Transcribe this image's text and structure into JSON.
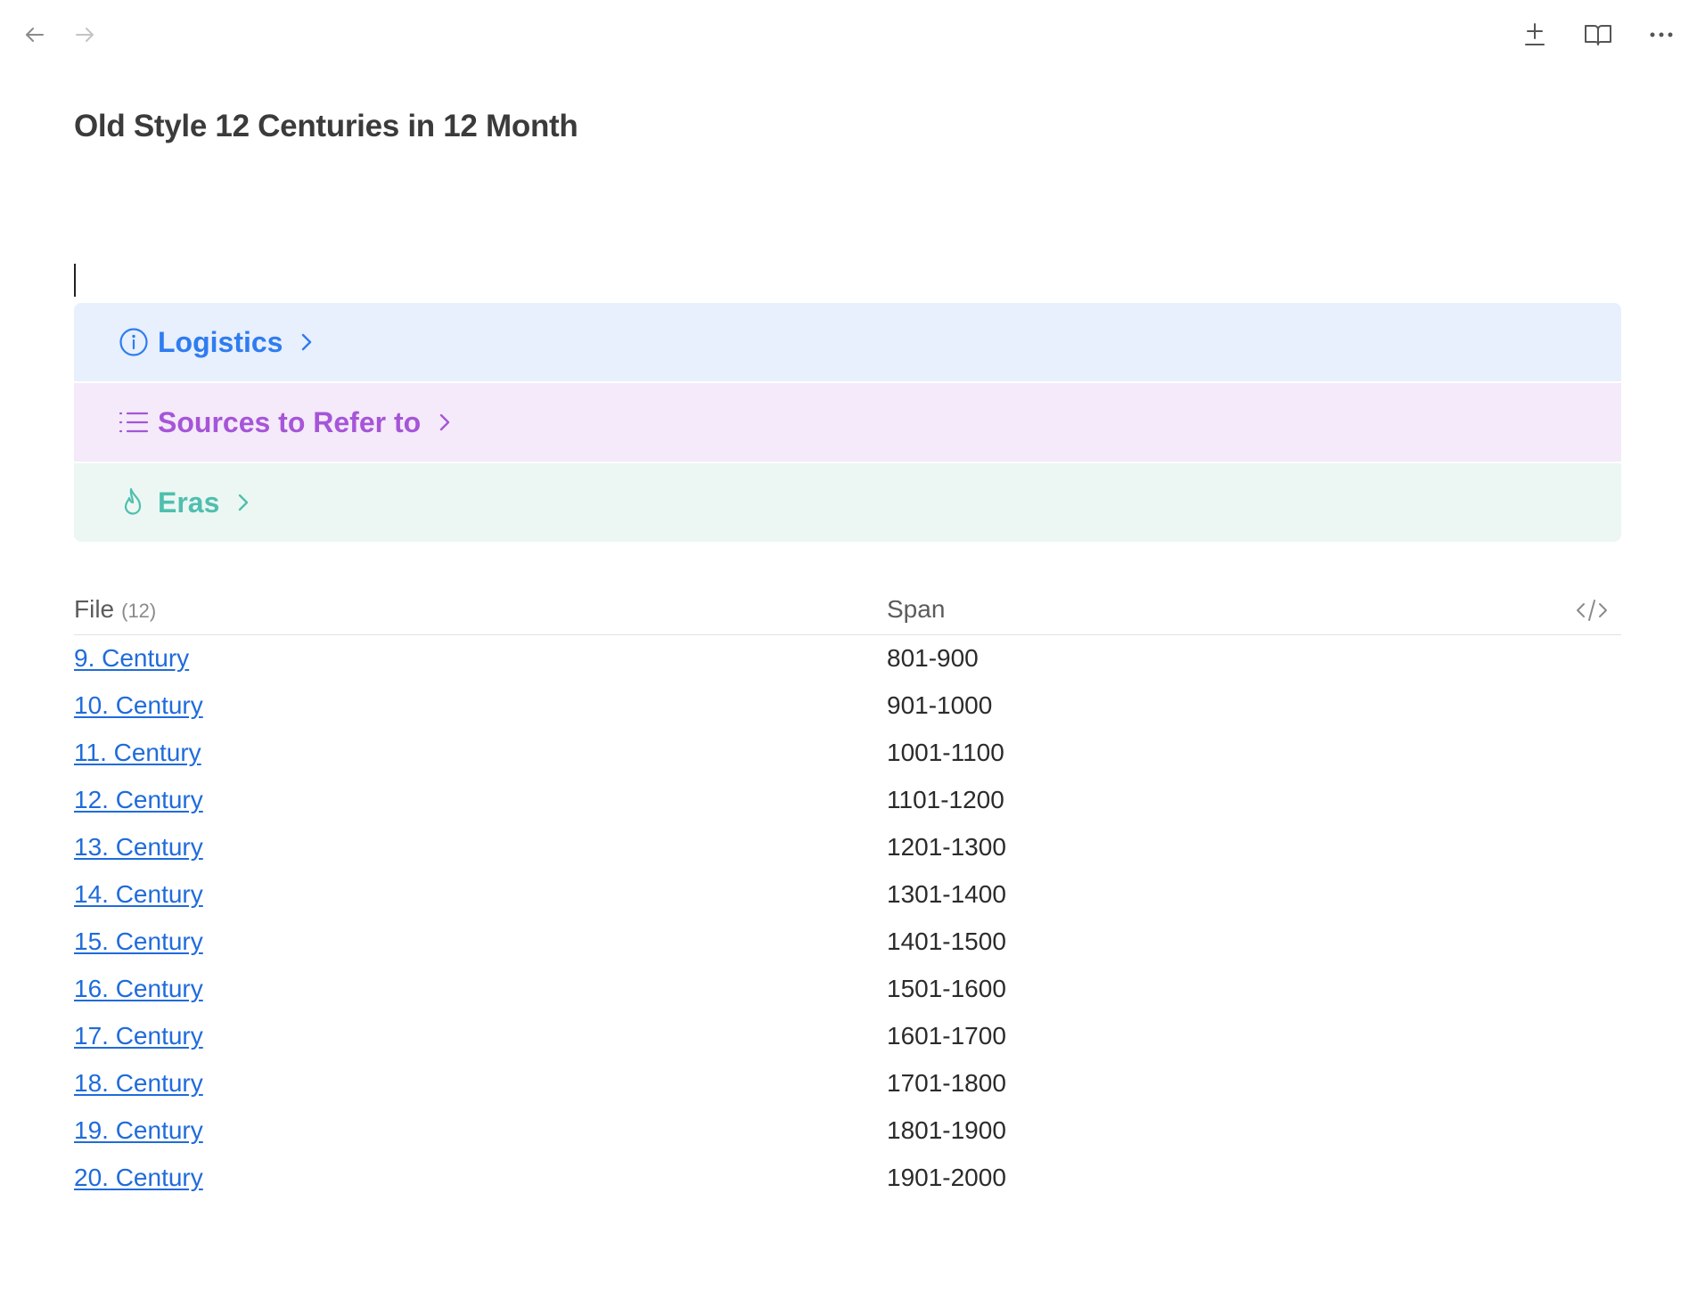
{
  "colors": {
    "logistics_bg": "#e8effd",
    "logistics_fg": "#2e7cf0",
    "sources_bg": "#f4eafa",
    "sources_fg": "#a655d8",
    "eras_bg": "#ecf7f4",
    "eras_fg": "#4fbfae",
    "link": "#1f6bdb"
  },
  "toolbar": {
    "back_icon": "arrow-left-icon",
    "forward_icon": "arrow-right-icon",
    "add_icon": "plus-minus-icon",
    "reading_icon": "book-open-icon",
    "more_icon": "more-horizontal-icon"
  },
  "page": {
    "title": "Old Style 12 Centuries in 12 Month"
  },
  "callouts": [
    {
      "title": "Logistics",
      "icon": "info-icon"
    },
    {
      "title": "Sources to Refer to",
      "icon": "list-icon"
    },
    {
      "title": "Eras",
      "icon": "flame-icon"
    }
  ],
  "table": {
    "columns": {
      "file": "File",
      "file_count": "(12)",
      "span": "Span"
    },
    "code_icon": "code-icon",
    "rows": [
      {
        "file": "9. Century",
        "span": "801-900"
      },
      {
        "file": "10. Century",
        "span": "901-1000"
      },
      {
        "file": "11. Century",
        "span": "1001-1100"
      },
      {
        "file": "12. Century",
        "span": "1101-1200"
      },
      {
        "file": "13. Century",
        "span": "1201-1300"
      },
      {
        "file": "14. Century",
        "span": "1301-1400"
      },
      {
        "file": "15. Century",
        "span": "1401-1500"
      },
      {
        "file": "16. Century",
        "span": "1501-1600"
      },
      {
        "file": "17. Century",
        "span": "1601-1700"
      },
      {
        "file": "18. Century",
        "span": "1701-1800"
      },
      {
        "file": "19. Century",
        "span": "1801-1900"
      },
      {
        "file": "20. Century",
        "span": "1901-2000"
      }
    ]
  }
}
